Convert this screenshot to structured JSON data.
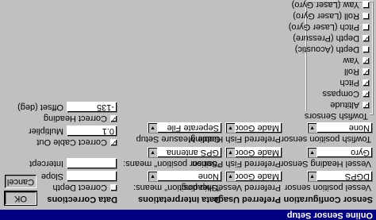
{
  "window": {
    "title": "Online Sensor Setup"
  },
  "columns": {
    "sensor_config": "Sensor Configuration",
    "preferred_usage": "Preferred Usage",
    "data_interpretations": "Data Interpretations",
    "data_corrections": "Data Corrections"
  },
  "sensor_config": {
    "vessel_position_label": "Vessel position sensor",
    "vessel_position_value": "DGPS",
    "vessel_heading_label": "Vessel Heading Sensor",
    "vessel_heading_value": "Gyro",
    "towfish_position_label": "Towfish position sensor",
    "towfish_position_value": "None",
    "towfish_sensors": {
      "title": "Towfish Sensors",
      "items": [
        {
          "label": "Altitude",
          "checked": true
        },
        {
          "label": "Compass",
          "checked": true
        },
        {
          "label": "Pitch",
          "checked": true
        },
        {
          "label": "Roll",
          "checked": true
        },
        {
          "label": "Yaw",
          "checked": true
        },
        {
          "label": "Depth (Acoustic)",
          "checked": false
        },
        {
          "label": "Depth (Pressure)",
          "checked": true
        },
        {
          "label": "Pitch (Laser Gyro)",
          "checked": false
        },
        {
          "label": "Roll (Laser Gyro)",
          "checked": false
        },
        {
          "label": "Yaw (Laser Gyro)",
          "checked": false
        }
      ]
    }
  },
  "preferred_usage": {
    "vessel_heading_label": "Preferred Vessel Heading",
    "vessel_heading_value": "Made Good",
    "fish_position_label": "Preferred Fish Position",
    "fish_position_value": "Made Good",
    "fish_heading_label": "Preferred Fish Heading",
    "fish_heading_value": "Made Good"
  },
  "data_interpretations": {
    "ship_position_label": "\"Ship position\" means:",
    "ship_position_value": "None",
    "sensor_position_label": "\"Sensor position\" means:",
    "sensor_position_value": "GPS antenna",
    "cable_measure_label": "Cable Measure Setup",
    "cable_measure_value": "Seperate File"
  },
  "data_corrections": {
    "correct_depth_label": "Correct Depth",
    "correct_depth_checked": false,
    "slope_label": "Slope",
    "slope_value": "",
    "intercept_label": "Intercept",
    "intercept_value": "",
    "correct_cable_label": "Correct Cable Out",
    "correct_cable_checked": true,
    "multiplier_label": "Multiplier",
    "multiplier_value": "0.1",
    "correct_heading_label": "Correct Heading",
    "correct_heading_checked": true,
    "offset_label": "Offset (deg)",
    "offset_value": "-135"
  },
  "buttons": {
    "ok": "OK",
    "cancel": "Cancel"
  },
  "icons": {
    "dropdown": "▼",
    "check": "✓"
  }
}
